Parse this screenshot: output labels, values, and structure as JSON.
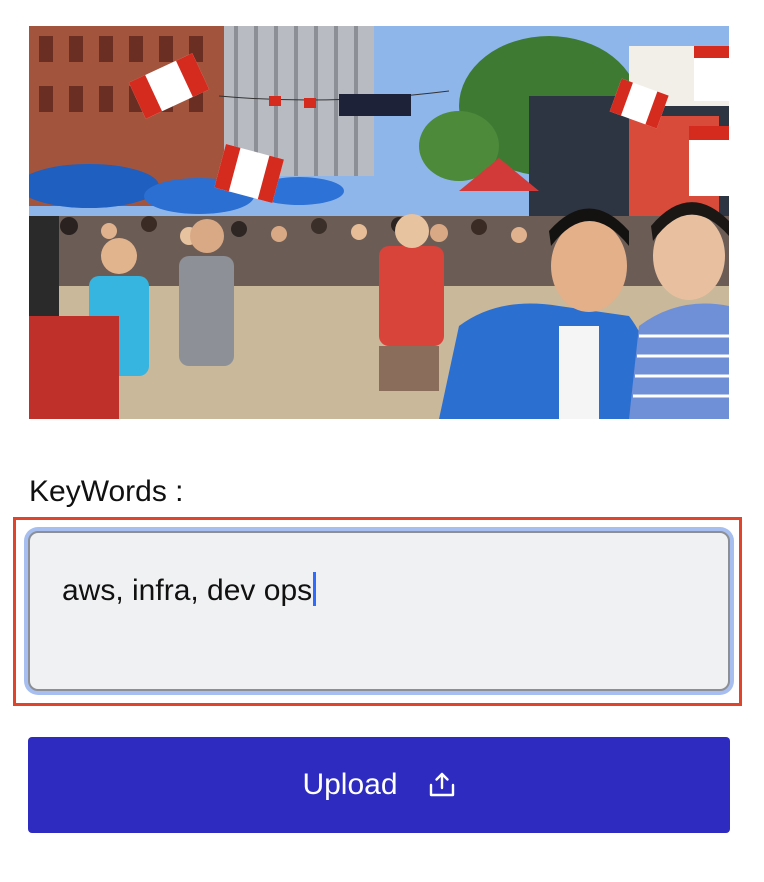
{
  "photo": {
    "alt": "",
    "icon": "street-festival-photo"
  },
  "keywords": {
    "label": "KeyWords :",
    "value": "aws, infra, dev ops"
  },
  "upload": {
    "label": "Upload",
    "icon": "upload-icon"
  },
  "colors": {
    "button_bg": "#2d2bc0",
    "button_text": "#ffffff",
    "input_bg": "#f0f1f3",
    "focus_ring": "#a7bff0",
    "highlight_border": "#e0452b",
    "caret": "#2f6bff"
  }
}
